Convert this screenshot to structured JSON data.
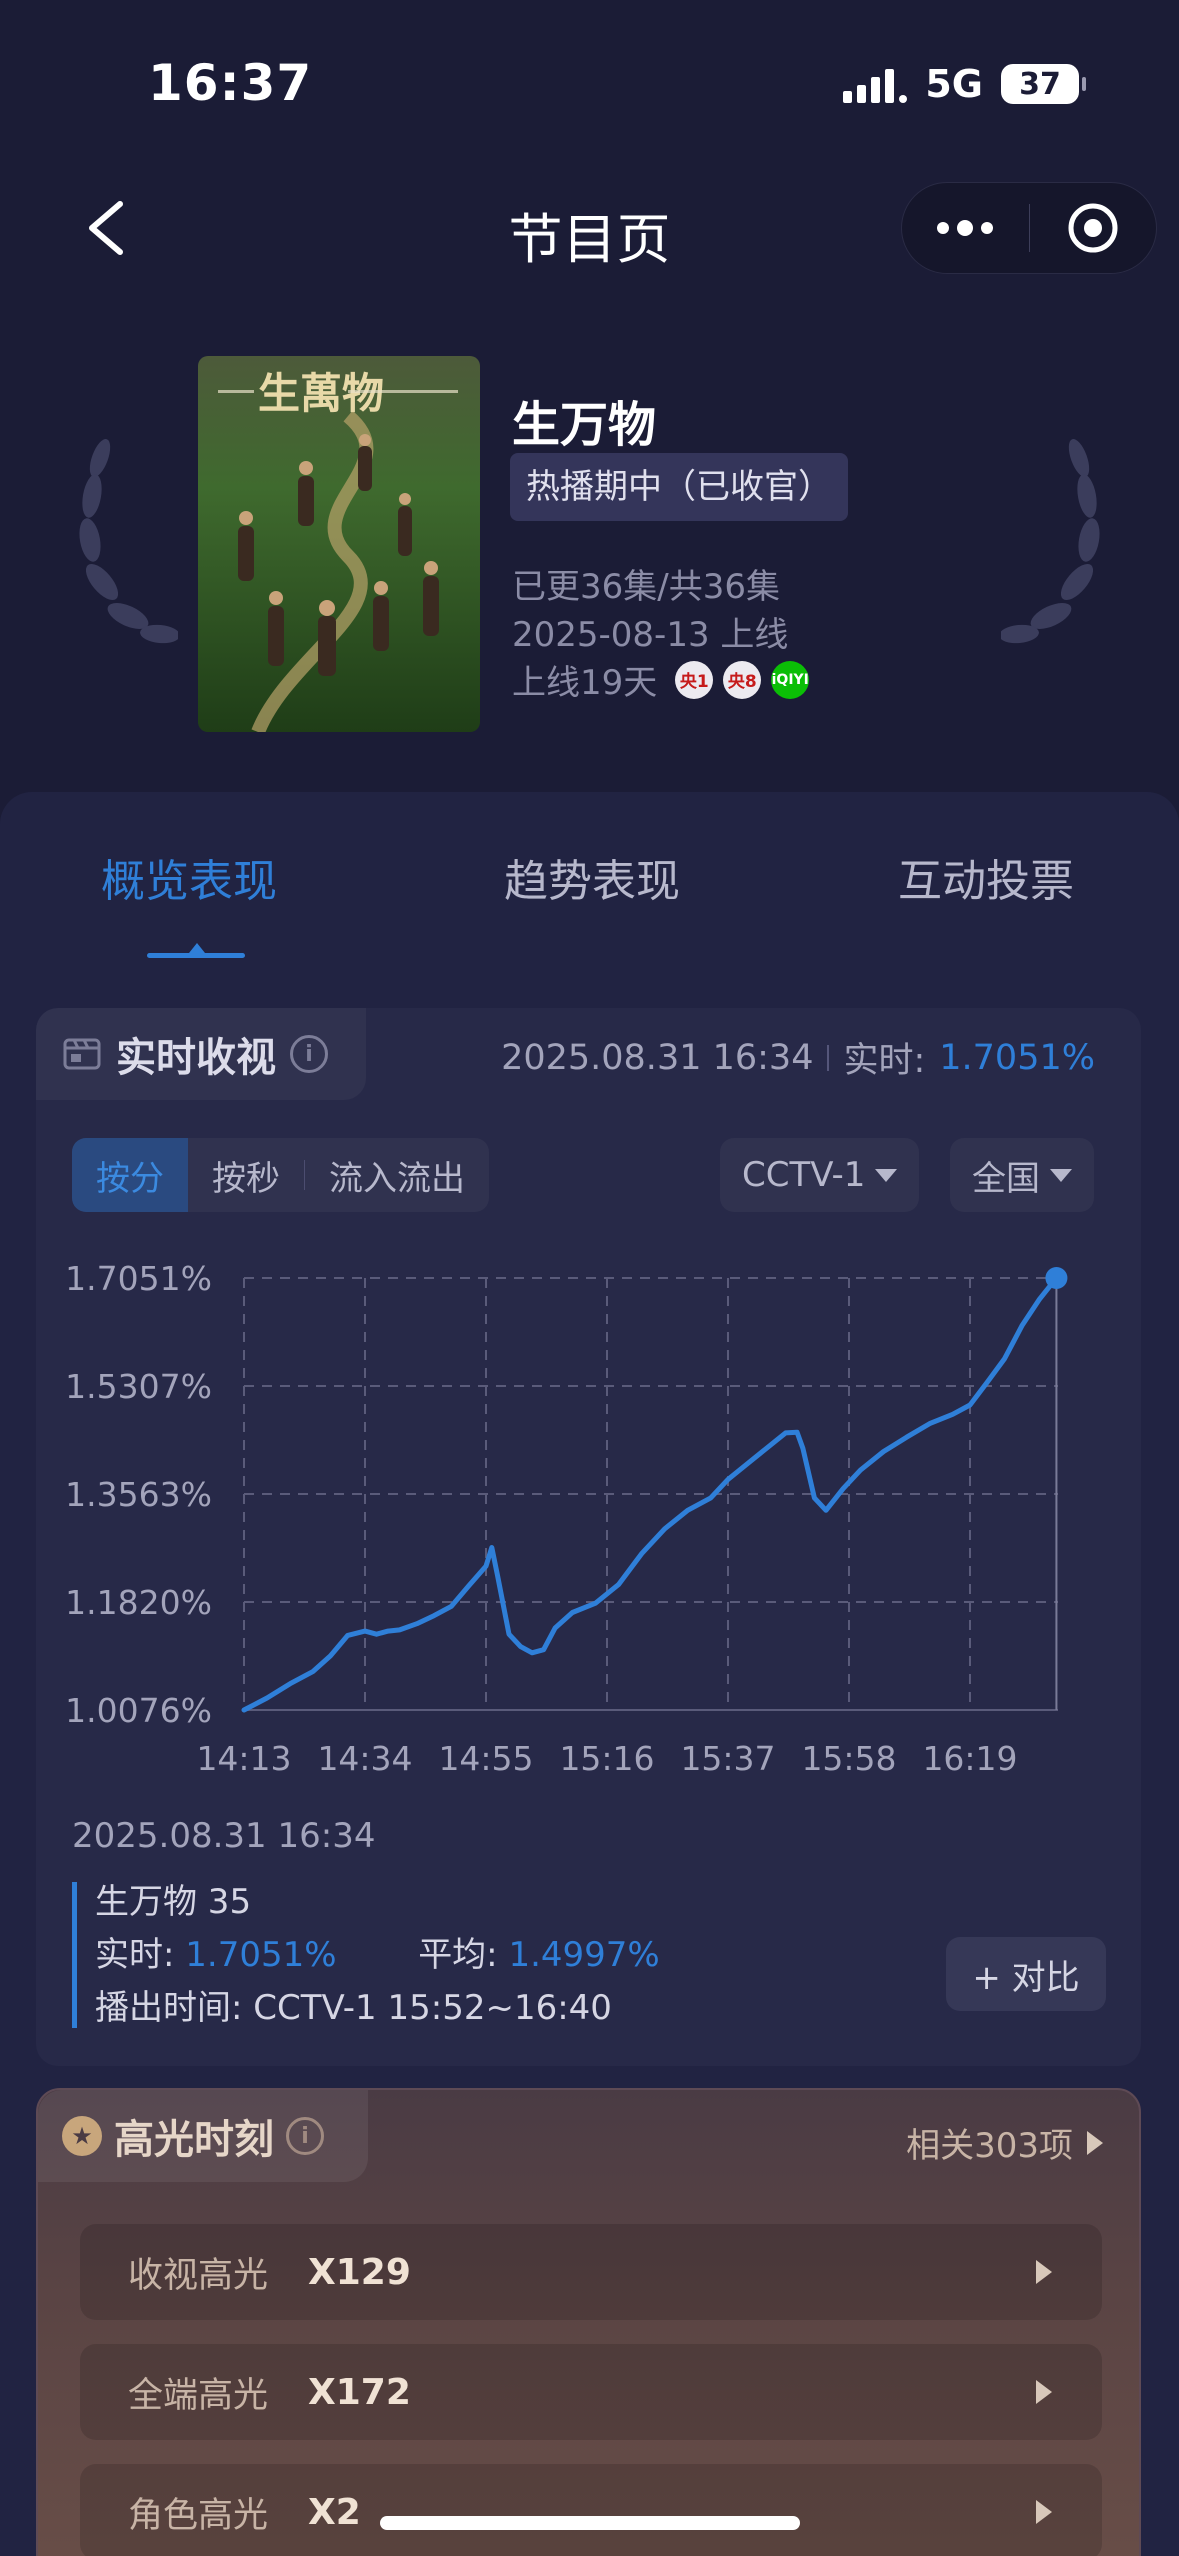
{
  "status": {
    "time": "16:37",
    "network": "5G",
    "battery": "37"
  },
  "nav": {
    "title": "节目页"
  },
  "show": {
    "title": "生万物",
    "status_badge": "热播期中（已收官）",
    "episodes": "已更36集/共36集",
    "release": "2025-08-13 上线",
    "days_online": "上线19天",
    "poster_title": "生萬物",
    "channels": [
      {
        "name": "央1"
      },
      {
        "name": "央8"
      },
      {
        "name": "iQIYI"
      }
    ]
  },
  "tabs": [
    {
      "label": "概览表现",
      "active": true
    },
    {
      "label": "趋势表现",
      "active": false
    },
    {
      "label": "互动投票",
      "active": false
    }
  ],
  "realtime": {
    "title": "实时收视",
    "datetime": "2025.08.31 16:34",
    "live_label": "实时:",
    "live_value": "1.7051%",
    "segments": [
      "按分",
      "按秒",
      "流入流出"
    ],
    "channel": "CCTV-1",
    "region": "全国"
  },
  "chart_data": {
    "type": "line",
    "title": "",
    "xlabel": "",
    "ylabel": "",
    "y_ticks": [
      "1.7051%",
      "1.5307%",
      "1.3563%",
      "1.1820%",
      "1.0076%"
    ],
    "ylim": [
      1.0076,
      1.7051
    ],
    "x_ticks": [
      "14:13",
      "14:34",
      "14:55",
      "15:16",
      "15:37",
      "15:58",
      "16:19"
    ],
    "grid": true,
    "series": [
      {
        "color": "#2f7fd8",
        "points": [
          [
            "14:13",
            1.0076
          ],
          [
            "14:17",
            1.027
          ],
          [
            "14:21",
            1.05
          ],
          [
            "14:25",
            1.07
          ],
          [
            "14:28",
            1.095
          ],
          [
            "14:31",
            1.128
          ],
          [
            "14:34",
            1.135
          ],
          [
            "14:36",
            1.13
          ],
          [
            "14:38",
            1.135
          ],
          [
            "14:40",
            1.137
          ],
          [
            "14:43",
            1.147
          ],
          [
            "14:46",
            1.16
          ],
          [
            "14:49",
            1.175
          ],
          [
            "14:52",
            1.208
          ],
          [
            "14:55",
            1.24
          ],
          [
            "14:56",
            1.27
          ],
          [
            "14:57",
            1.225
          ],
          [
            "14:59",
            1.13
          ],
          [
            "15:01",
            1.11
          ],
          [
            "15:03",
            1.1
          ],
          [
            "15:05",
            1.105
          ],
          [
            "15:07",
            1.14
          ],
          [
            "15:10",
            1.165
          ],
          [
            "15:14",
            1.18
          ],
          [
            "15:18",
            1.21
          ],
          [
            "15:22",
            1.26
          ],
          [
            "15:26",
            1.3
          ],
          [
            "15:30",
            1.33
          ],
          [
            "15:34",
            1.35
          ],
          [
            "15:37",
            1.38
          ],
          [
            "15:41",
            1.41
          ],
          [
            "15:45",
            1.44
          ],
          [
            "15:47",
            1.455
          ],
          [
            "15:49",
            1.456
          ],
          [
            "15:50",
            1.43
          ],
          [
            "15:52",
            1.35
          ],
          [
            "15:54",
            1.33
          ],
          [
            "15:57",
            1.365
          ],
          [
            "16:00",
            1.395
          ],
          [
            "16:04",
            1.425
          ],
          [
            "16:08",
            1.448
          ],
          [
            "16:12",
            1.47
          ],
          [
            "16:16",
            1.485
          ],
          [
            "16:19",
            1.5
          ],
          [
            "16:22",
            1.537
          ],
          [
            "16:25",
            1.575
          ],
          [
            "16:28",
            1.628
          ],
          [
            "16:31",
            1.67
          ],
          [
            "16:34",
            1.7051
          ]
        ]
      }
    ]
  },
  "detail": {
    "datetime": "2025.08.31 16:34",
    "show_line": "生万物 35",
    "live_label": "实时:",
    "live_value": "1.7051%",
    "avg_label": "平均:",
    "avg_value": "1.4997%",
    "airtime": "播出时间:  CCTV-1 15:52~16:40",
    "compare_btn": "+ 对比"
  },
  "highlights": {
    "title": "高光时刻",
    "related": "相关303项",
    "rows": [
      {
        "label": "收视高光",
        "value": "X129"
      },
      {
        "label": "全端高光",
        "value": "X172"
      },
      {
        "label": "角色高光",
        "value": "X2"
      }
    ]
  }
}
